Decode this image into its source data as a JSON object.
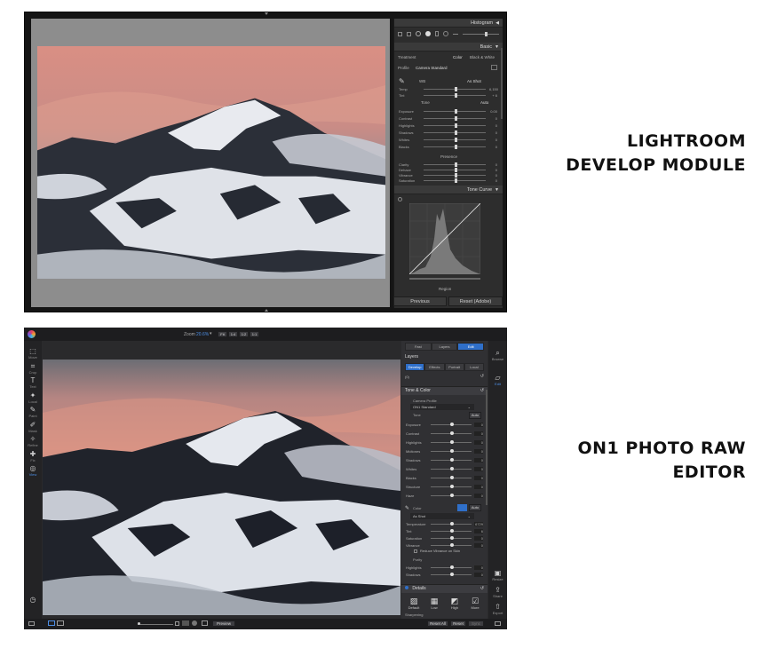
{
  "captions": {
    "lightroom": [
      "LIGHTROOM",
      "DEVELOP MODULE"
    ],
    "on1": [
      "ON1 PHOTO RAW",
      "EDITOR"
    ]
  },
  "lightroom": {
    "histogram_header": "Histogram",
    "basic_header": "Basic",
    "treatment_label": "Treatment",
    "treatment_color": "Color",
    "treatment_bw": "Black & White",
    "profile_label": "Profile",
    "profile_value": "Camera Standard",
    "wb_label": "WB",
    "wb_value": "As Shot",
    "wb_rows": [
      {
        "label": "Temp",
        "value": "6,150"
      },
      {
        "label": "Tint",
        "value": "+ 6"
      }
    ],
    "tone_label": "Tone",
    "tone_auto": "Auto",
    "tone_rows": [
      {
        "label": "Exposure",
        "value": "0.00"
      },
      {
        "label": "Contrast",
        "value": "0"
      },
      {
        "label": "Highlights",
        "value": "0"
      },
      {
        "label": "Shadows",
        "value": "0"
      },
      {
        "label": "Whites",
        "value": "0"
      },
      {
        "label": "Blacks",
        "value": "0"
      }
    ],
    "presence_label": "Presence",
    "presence_rows": [
      {
        "label": "Clarity",
        "value": "0"
      },
      {
        "label": "Dehaze",
        "value": "0"
      },
      {
        "label": "Vibrance",
        "value": "0"
      },
      {
        "label": "Saturation",
        "value": "0"
      }
    ],
    "tone_curve_header": "Tone Curve",
    "region_label": "Region",
    "previous_button": "Previous",
    "reset_button": "Reset (Adobe)"
  },
  "on1": {
    "zoom_label": "Zoom",
    "zoom_value": "20.6%",
    "zoom_presets": [
      "Fit",
      "1:4",
      "1:2",
      "1:1"
    ],
    "tools": [
      "Move",
      "Crop",
      "Text",
      "Local",
      "Paint",
      "Mask",
      "Refine",
      "Fix",
      "View"
    ],
    "top_tabs": [
      "Fast",
      "Layers",
      "Edit"
    ],
    "top_tab_active": 2,
    "layers_header": "Layers",
    "mode_tabs": [
      "Develop",
      "Effects",
      "Portrait",
      "Local"
    ],
    "mode_tab_active": 0,
    "layer_item": "(0)",
    "tone_color_header": "Tone & Color",
    "camera_profile_label": "Camera Profile",
    "camera_profile_value": "ON1 Standard",
    "tone_label": "Tone",
    "tone_auto": "Auto",
    "tone_rows": [
      {
        "label": "Exposure",
        "value": "0"
      },
      {
        "label": "Contrast",
        "value": "0"
      },
      {
        "label": "Highlights",
        "value": "0"
      },
      {
        "label": "Midtones",
        "value": "0"
      },
      {
        "label": "Shadows",
        "value": "0"
      },
      {
        "label": "Whites",
        "value": "0"
      },
      {
        "label": "Blacks",
        "value": "0"
      },
      {
        "label": "Structure",
        "value": "0"
      },
      {
        "label": "Haze",
        "value": "0"
      }
    ],
    "color_label": "Color",
    "color_mode_value": "As Shot",
    "color_rows": [
      {
        "label": "Temperature",
        "value": "6729"
      },
      {
        "label": "Tint",
        "value": "6"
      },
      {
        "label": "Saturation",
        "value": "0"
      },
      {
        "label": "Vibrance",
        "value": "0"
      }
    ],
    "reduce_vibrance_label": "Reduce Vibrance on Skin",
    "purity_label": "Purity",
    "purity_rows": [
      {
        "label": "Highlights",
        "value": "0"
      },
      {
        "label": "Shadows",
        "value": "0"
      }
    ],
    "details_header": "Details",
    "detail_presets": [
      "Default",
      "Low",
      "High",
      "More"
    ],
    "sharpening_label": "Sharpening",
    "sharpening_rows": [
      {
        "label": "Amount",
        "value": "0"
      },
      {
        "label": "Threshold",
        "value": "0"
      }
    ],
    "right_tools": [
      "Browse",
      "Edit",
      "Resize",
      "Share",
      "Export"
    ],
    "preview_button": "Preview",
    "reset_all_button": "Reset All",
    "reset_button": "Reset",
    "sync_button": "Sync",
    "accent_color": "#2f6fc9"
  }
}
